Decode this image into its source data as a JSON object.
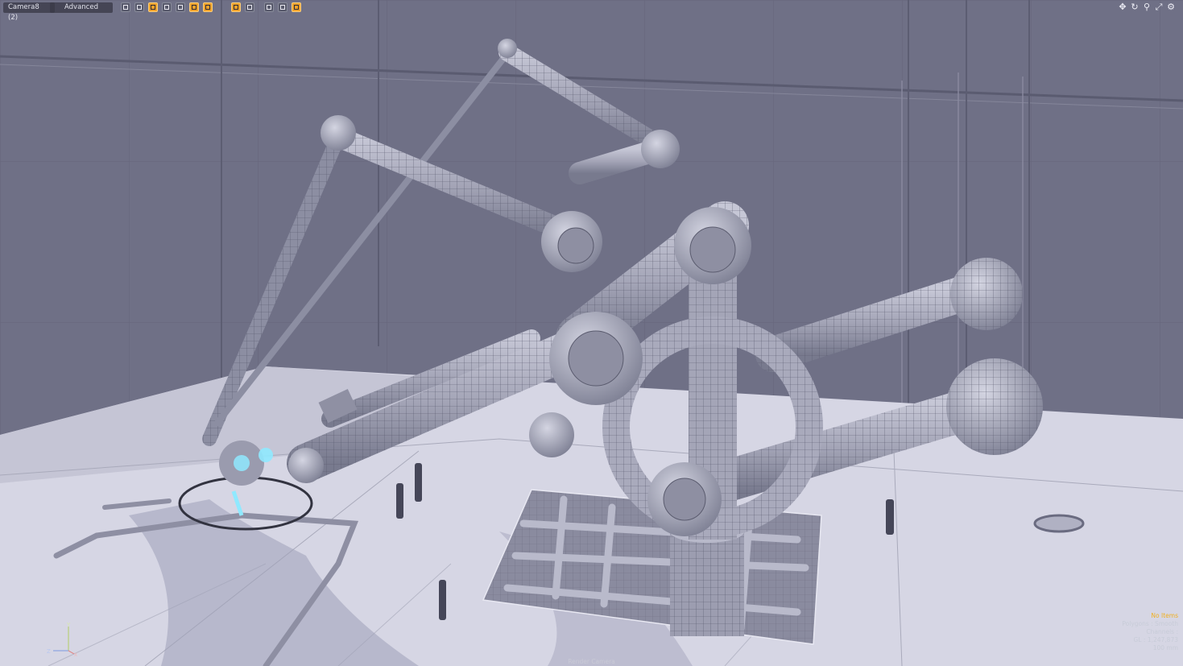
{
  "toolbar": {
    "camera_tab": "Camera8 (2)",
    "preset_tab": "Advanced",
    "buttons": [
      {
        "icon": "checker-grid-icon",
        "active": false
      },
      {
        "icon": "wire-grid-icon",
        "active": false
      },
      {
        "icon": "shaded-icon",
        "active": true
      },
      {
        "icon": "wire-shaded-icon",
        "active": false
      },
      {
        "icon": "textured-icon",
        "active": false
      },
      {
        "icon": "light-a-icon",
        "active": true
      },
      {
        "icon": "light-b-icon",
        "active": true
      },
      {
        "icon": "safe-frame-icon",
        "active": true
      },
      {
        "icon": "stripe-icon",
        "active": false
      },
      {
        "icon": "camera-frame-icon",
        "active": false
      },
      {
        "icon": "eye-icon",
        "active": false
      },
      {
        "icon": "film-icon",
        "active": true
      }
    ]
  },
  "nav_icons": [
    "move-view-icon",
    "rotate-view-icon",
    "zoom-view-icon",
    "fit-view-icon",
    "settings-icon"
  ],
  "hud": {
    "line1": "No Items",
    "line2": "Polygons : Smooth",
    "line3": "Channels : ",
    "line4": "GL : 1,247,873",
    "line5": "100 mm"
  },
  "footer": {
    "render_camera": "Render Camera"
  },
  "axis": {
    "y_label": "Y",
    "z_label": "Z",
    "x_label": "X"
  },
  "colors": {
    "wall": "#6f7086",
    "floor": "#d6d6e4",
    "model": "#a5a6b8",
    "active_button": "#f0a02a",
    "hud_accent": "#f0b020",
    "glow": "#8fe9ff"
  }
}
